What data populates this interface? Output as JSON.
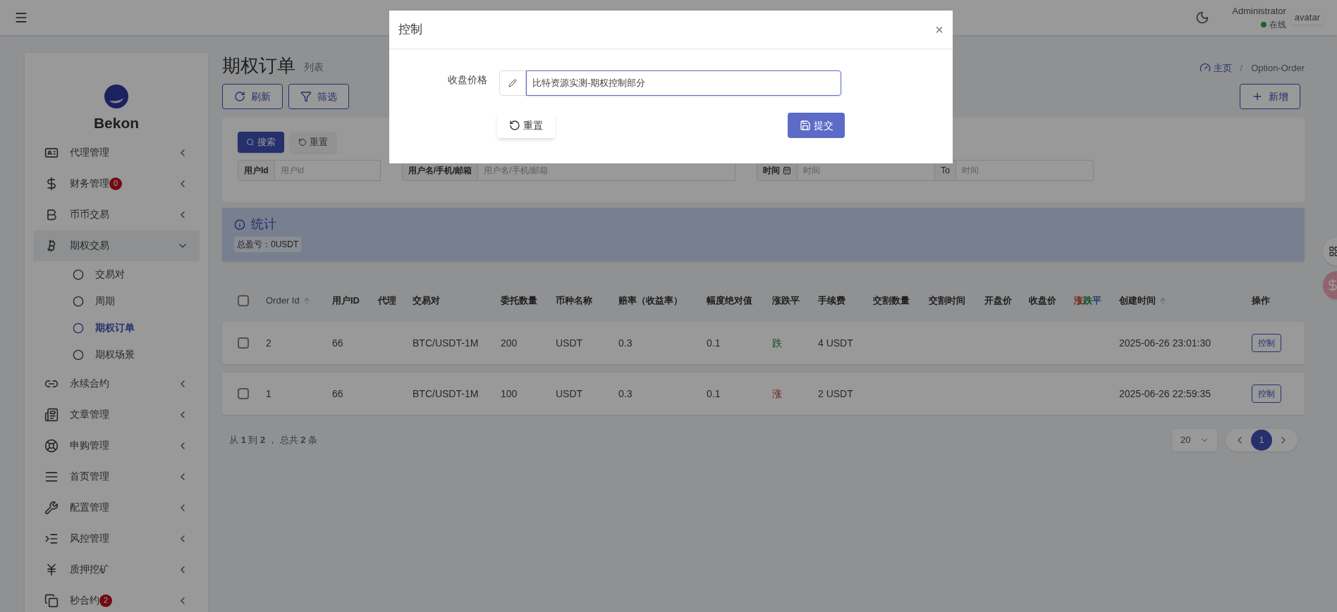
{
  "header": {
    "user_name": "Administrator",
    "status": "在线",
    "avatar_alt": "avatar"
  },
  "sidebar": {
    "brand": "Bekon",
    "items": [
      {
        "kind": "id-card",
        "label": "代理管理",
        "expanded": false
      },
      {
        "kind": "dollar",
        "label": "财务管理",
        "badge": "0",
        "expanded": false
      },
      {
        "kind": "letter-b",
        "label": "币币交易",
        "expanded": false
      },
      {
        "kind": "bitcoin",
        "label": "期权交易",
        "expanded": true,
        "children": [
          {
            "label": "交易对",
            "selected": false
          },
          {
            "label": "周期",
            "selected": false
          },
          {
            "label": "期权订单",
            "selected": true
          },
          {
            "label": "期权场景",
            "selected": false
          }
        ]
      },
      {
        "kind": "link",
        "label": "永续合约",
        "expanded": false
      },
      {
        "kind": "newspaper",
        "label": "文章管理",
        "expanded": false
      },
      {
        "kind": "lifebuoy",
        "label": "申购管理",
        "expanded": false
      },
      {
        "kind": "lines",
        "label": "首页管理",
        "expanded": false
      },
      {
        "kind": "wrench",
        "label": "配置管理",
        "expanded": false
      },
      {
        "kind": "indent",
        "label": "风控管理",
        "expanded": false
      },
      {
        "kind": "yen",
        "label": "质押挖矿",
        "expanded": false
      },
      {
        "kind": "copy",
        "label": "秒合约",
        "badge": "2",
        "expanded": false
      }
    ]
  },
  "page": {
    "title": "期权订单",
    "subtitle": "列表",
    "breadcrumb": [
      "主页",
      "Option-Order"
    ],
    "breadcrumb_separator": "/",
    "toolbar": [
      "刷新",
      "筛选"
    ],
    "add_button": "新增"
  },
  "filter": {
    "buttons": [
      "搜索",
      "重置"
    ],
    "fields": [
      {
        "label": "用户Id",
        "placeholder": "用户id"
      },
      {
        "label": "用户名/手机/邮箱",
        "placeholder": "用户名/手机/邮箱"
      },
      {
        "label": "时间",
        "placeholder": "时间",
        "to_label": "To",
        "to_placeholder": "时间"
      }
    ]
  },
  "stats": {
    "title": "统计",
    "total": "总盈亏：0USDT"
  },
  "table": {
    "select_all_checked": false,
    "columns": [
      {
        "label": "Order Id",
        "sortable": true
      },
      {
        "label": "用户ID"
      },
      {
        "label": "代理"
      },
      {
        "label": "交易对"
      },
      {
        "label": "委托数量"
      },
      {
        "label": "币种名称"
      },
      {
        "label": "赔率（收益率）"
      },
      {
        "label": "幅度绝对值"
      },
      {
        "label": "涨跌平"
      },
      {
        "label": "手续费"
      },
      {
        "label": "交割数量"
      },
      {
        "label": "交割时间"
      },
      {
        "label": "开盘价"
      },
      {
        "label": "收盘价"
      },
      {
        "parts": [
          {
            "text": "涨",
            "kind": "rise"
          },
          {
            "text": "跌",
            "kind": "fall"
          },
          {
            "text": "平",
            "kind": "flat"
          }
        ]
      },
      {
        "label": "创建时间",
        "sortable": true
      },
      {
        "label": "操作"
      }
    ],
    "rows": [
      {
        "checked": false,
        "cells": [
          "2",
          "66",
          "",
          "BTC/USDT-1M",
          "200",
          "USDT",
          "0.3",
          "0.1",
          "跌",
          "4 USDT",
          "",
          "",
          "",
          "",
          "",
          "2025-06-26 23:01:30"
        ],
        "kind": "fall",
        "action": "控制"
      },
      {
        "checked": false,
        "cells": [
          "1",
          "66",
          "",
          "BTC/USDT-1M",
          "100",
          "USDT",
          "0.3",
          "0.1",
          "涨",
          "2 USDT",
          "",
          "",
          "",
          "",
          "",
          "2025-06-26 22:59:35"
        ],
        "kind": "rise",
        "action": "控制"
      }
    ]
  },
  "pagination": {
    "summary": "从 **1** 到 **2** ， 总共 **2** 条",
    "page_size": "20",
    "pages": [
      {
        "label": "1",
        "selected": true
      }
    ]
  },
  "modal": {
    "title": "控制",
    "close": "×",
    "field_label": "收盘价格",
    "field_value": "比特资源实测-期权控制部分",
    "reset": "重置",
    "submit": "提交"
  }
}
